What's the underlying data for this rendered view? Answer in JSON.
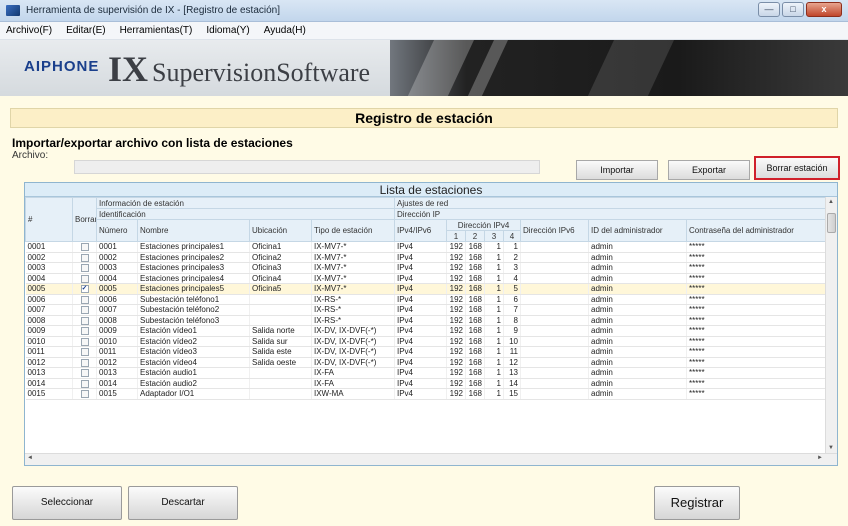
{
  "window": {
    "title": "Herramienta de supervisión de IX - [Registro de estación]",
    "min": "—",
    "max": "□",
    "close": "x"
  },
  "menu": [
    "Archivo(F)",
    "Editar(E)",
    "Herramientas(T)",
    "Idioma(Y)",
    "Ayuda(H)"
  ],
  "banner": {
    "logo": "AIPHONE",
    "ix": "IX",
    "software": "SupervisionSoftware"
  },
  "page": {
    "header": "Registro de estación",
    "section_title": "Importar/exportar archivo con lista de estaciones",
    "archivo_label": "Archivo:",
    "import_label": "Importar",
    "export_label": "Exportar",
    "delete_label": "Borrar estación"
  },
  "table": {
    "caption": "Lista de estaciones",
    "headers": {
      "num": "#",
      "borrar": "Borrar",
      "info_estacion": "Información de estación",
      "identificacion": "Identificación",
      "numero": "Número",
      "nombre": "Nombre",
      "ubicacion": "Ubicación",
      "tipo": "Tipo de estación",
      "ajustes_red": "Ajustes de red",
      "direccion_ip": "Dirección IP",
      "ipv4ipv6": "IPv4/IPv6",
      "direccion_ipv4": "Dirección IPv4",
      "o1": "1",
      "o2": "2",
      "o3": "3",
      "o4": "4",
      "ipv6": "Dirección IPv6",
      "admin_id": "ID del administrador",
      "admin_pw": "Contraseña del administrador"
    },
    "rows": [
      {
        "idx": "0001",
        "checked": false,
        "numero": "0001",
        "nombre": "Estaciones principales1",
        "ubicacion": "Oficina1",
        "tipo": "IX-MV7-*",
        "ip": "IPv4",
        "o1": "192",
        "o2": "168",
        "o3": "1",
        "o4": "1",
        "ipv6": "",
        "admin": "admin",
        "pw": "*****"
      },
      {
        "idx": "0002",
        "checked": false,
        "numero": "0002",
        "nombre": "Estaciones principales2",
        "ubicacion": "Oficina2",
        "tipo": "IX-MV7-*",
        "ip": "IPv4",
        "o1": "192",
        "o2": "168",
        "o3": "1",
        "o4": "2",
        "ipv6": "",
        "admin": "admin",
        "pw": "*****"
      },
      {
        "idx": "0003",
        "checked": false,
        "numero": "0003",
        "nombre": "Estaciones principales3",
        "ubicacion": "Oficina3",
        "tipo": "IX-MV7-*",
        "ip": "IPv4",
        "o1": "192",
        "o2": "168",
        "o3": "1",
        "o4": "3",
        "ipv6": "",
        "admin": "admin",
        "pw": "*****"
      },
      {
        "idx": "0004",
        "checked": false,
        "numero": "0004",
        "nombre": "Estaciones principales4",
        "ubicacion": "Oficina4",
        "tipo": "IX-MV7-*",
        "ip": "IPv4",
        "o1": "192",
        "o2": "168",
        "o3": "1",
        "o4": "4",
        "ipv6": "",
        "admin": "admin",
        "pw": "*****"
      },
      {
        "idx": "0005",
        "checked": true,
        "numero": "0005",
        "nombre": "Estaciones principales5",
        "ubicacion": "Oficina5",
        "tipo": "IX-MV7-*",
        "ip": "IPv4",
        "o1": "192",
        "o2": "168",
        "o3": "1",
        "o4": "5",
        "ipv6": "",
        "admin": "admin",
        "pw": "*****"
      },
      {
        "idx": "0006",
        "checked": false,
        "numero": "0006",
        "nombre": "Subestación teléfono1",
        "ubicacion": "",
        "tipo": "IX-RS-*",
        "ip": "IPv4",
        "o1": "192",
        "o2": "168",
        "o3": "1",
        "o4": "6",
        "ipv6": "",
        "admin": "admin",
        "pw": "*****"
      },
      {
        "idx": "0007",
        "checked": false,
        "numero": "0007",
        "nombre": "Subestación teléfono2",
        "ubicacion": "",
        "tipo": "IX-RS-*",
        "ip": "IPv4",
        "o1": "192",
        "o2": "168",
        "o3": "1",
        "o4": "7",
        "ipv6": "",
        "admin": "admin",
        "pw": "*****"
      },
      {
        "idx": "0008",
        "checked": false,
        "numero": "0008",
        "nombre": "Subestación teléfono3",
        "ubicacion": "",
        "tipo": "IX-RS-*",
        "ip": "IPv4",
        "o1": "192",
        "o2": "168",
        "o3": "1",
        "o4": "8",
        "ipv6": "",
        "admin": "admin",
        "pw": "*****"
      },
      {
        "idx": "0009",
        "checked": false,
        "numero": "0009",
        "nombre": "Estación vídeo1",
        "ubicacion": "Salida norte",
        "tipo": "IX-DV, IX-DVF(-*)",
        "ip": "IPv4",
        "o1": "192",
        "o2": "168",
        "o3": "1",
        "o4": "9",
        "ipv6": "",
        "admin": "admin",
        "pw": "*****"
      },
      {
        "idx": "0010",
        "checked": false,
        "numero": "0010",
        "nombre": "Estación vídeo2",
        "ubicacion": "Salida sur",
        "tipo": "IX-DV, IX-DVF(-*)",
        "ip": "IPv4",
        "o1": "192",
        "o2": "168",
        "o3": "1",
        "o4": "10",
        "ipv6": "",
        "admin": "admin",
        "pw": "*****"
      },
      {
        "idx": "0011",
        "checked": false,
        "numero": "0011",
        "nombre": "Estación vídeo3",
        "ubicacion": "Salida este",
        "tipo": "IX-DV, IX-DVF(-*)",
        "ip": "IPv4",
        "o1": "192",
        "o2": "168",
        "o3": "1",
        "o4": "11",
        "ipv6": "",
        "admin": "admin",
        "pw": "*****"
      },
      {
        "idx": "0012",
        "checked": false,
        "numero": "0012",
        "nombre": "Estación vídeo4",
        "ubicacion": "Salida oeste",
        "tipo": "IX-DV, IX-DVF(-*)",
        "ip": "IPv4",
        "o1": "192",
        "o2": "168",
        "o3": "1",
        "o4": "12",
        "ipv6": "",
        "admin": "admin",
        "pw": "*****"
      },
      {
        "idx": "0013",
        "checked": false,
        "numero": "0013",
        "nombre": "Estación audio1",
        "ubicacion": "",
        "tipo": "IX-FA",
        "ip": "IPv4",
        "o1": "192",
        "o2": "168",
        "o3": "1",
        "o4": "13",
        "ipv6": "",
        "admin": "admin",
        "pw": "*****"
      },
      {
        "idx": "0014",
        "checked": false,
        "numero": "0014",
        "nombre": "Estación audio2",
        "ubicacion": "",
        "tipo": "IX-FA",
        "ip": "IPv4",
        "o1": "192",
        "o2": "168",
        "o3": "1",
        "o4": "14",
        "ipv6": "",
        "admin": "admin",
        "pw": "*****"
      },
      {
        "idx": "0015",
        "checked": false,
        "numero": "0015",
        "nombre": "Adaptador I/O1",
        "ubicacion": "",
        "tipo": "IXW-MA",
        "ip": "IPv4",
        "o1": "192",
        "o2": "168",
        "o3": "1",
        "o4": "15",
        "ipv6": "",
        "admin": "admin",
        "pw": "*****"
      }
    ]
  },
  "footer": {
    "select_label": "Seleccionar",
    "discard_label": "Descartar",
    "register_label": "Registrar"
  }
}
